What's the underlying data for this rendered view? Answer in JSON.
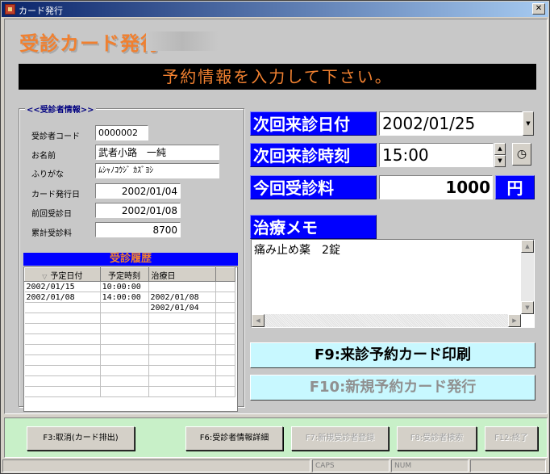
{
  "window": {
    "title": "カード発行",
    "close": "✕"
  },
  "header": {
    "title": "受診カード発行"
  },
  "banner": {
    "text": "予約情報を入力して下さい。"
  },
  "patient": {
    "group_label": "<<受診者情報>>",
    "fields": [
      {
        "label": "受診者コード",
        "value": "0000002"
      },
      {
        "label": "お名前",
        "value": "武者小路　一純"
      },
      {
        "label": "ふりがな",
        "value": "ﾑｼｬﾉｺｳｼﾞ ｶｽﾞﾖｼ"
      },
      {
        "label": "カード発行日",
        "value": "2002/01/04"
      },
      {
        "label": "前回受診日",
        "value": "2002/01/08"
      },
      {
        "label": "累計受診料",
        "value": "8700"
      }
    ]
  },
  "history": {
    "title": "受診履歴",
    "columns": [
      "予定日付",
      "予定時刻",
      "治療日"
    ],
    "rows": [
      [
        "2002/01/15",
        "10:00:00",
        ""
      ],
      [
        "2002/01/08",
        "14:00:00",
        "2002/01/08"
      ],
      [
        "",
        "",
        "2002/01/04"
      ]
    ]
  },
  "next_visit": {
    "date_label": "次回来診日付",
    "date_value": "2002/01/25",
    "time_label": "次回来診時刻",
    "time_value": "15:00"
  },
  "fee": {
    "label": "今回受診料",
    "value": "1000",
    "unit": "円"
  },
  "memo": {
    "label": "治療メモ",
    "text": "痛み止め薬　2錠"
  },
  "actions": {
    "print": "F9:来診予約カード印刷",
    "new_card": "F10:新規予約カード発行"
  },
  "fkeys": {
    "f3": "F3:取消(カード排出)",
    "f6": "F6:受診者情報詳細",
    "f7": "F7:新規受診者登録",
    "f8": "F8:受診者検索",
    "f12": "F12:終了"
  },
  "status": {
    "caps": "CAPS",
    "num": "NUM"
  }
}
